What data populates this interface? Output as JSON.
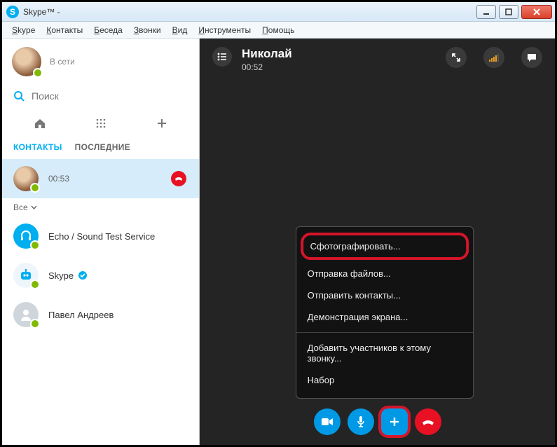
{
  "window": {
    "title": "Skype™ -"
  },
  "menu": [
    "Skype",
    "Контакты",
    "Беседа",
    "Звонки",
    "Вид",
    "Инструменты",
    "Помощь"
  ],
  "me": {
    "name": "",
    "status": "В сети"
  },
  "search": {
    "placeholder": "Поиск"
  },
  "tabs": {
    "contacts": "КОНТАКТЫ",
    "recent": "ПОСЛЕДНИЕ"
  },
  "filter": {
    "label": "Все"
  },
  "active_contact": {
    "name": "",
    "duration": "00:53"
  },
  "contacts": [
    {
      "name": "Echo / Sound Test Service"
    },
    {
      "name": "Skype"
    },
    {
      "name": "Павел Андреев"
    }
  ],
  "call": {
    "name": "Николай",
    "duration": "00:52"
  },
  "popup": {
    "snapshot": "Сфотографировать...",
    "send_files": "Отправка файлов...",
    "send_contacts": "Отправить контакты...",
    "share_screen": "Демонстрация экрана...",
    "add_people": "Добавить участников к этому звонку...",
    "dialpad": "Набор"
  },
  "watermark": ""
}
